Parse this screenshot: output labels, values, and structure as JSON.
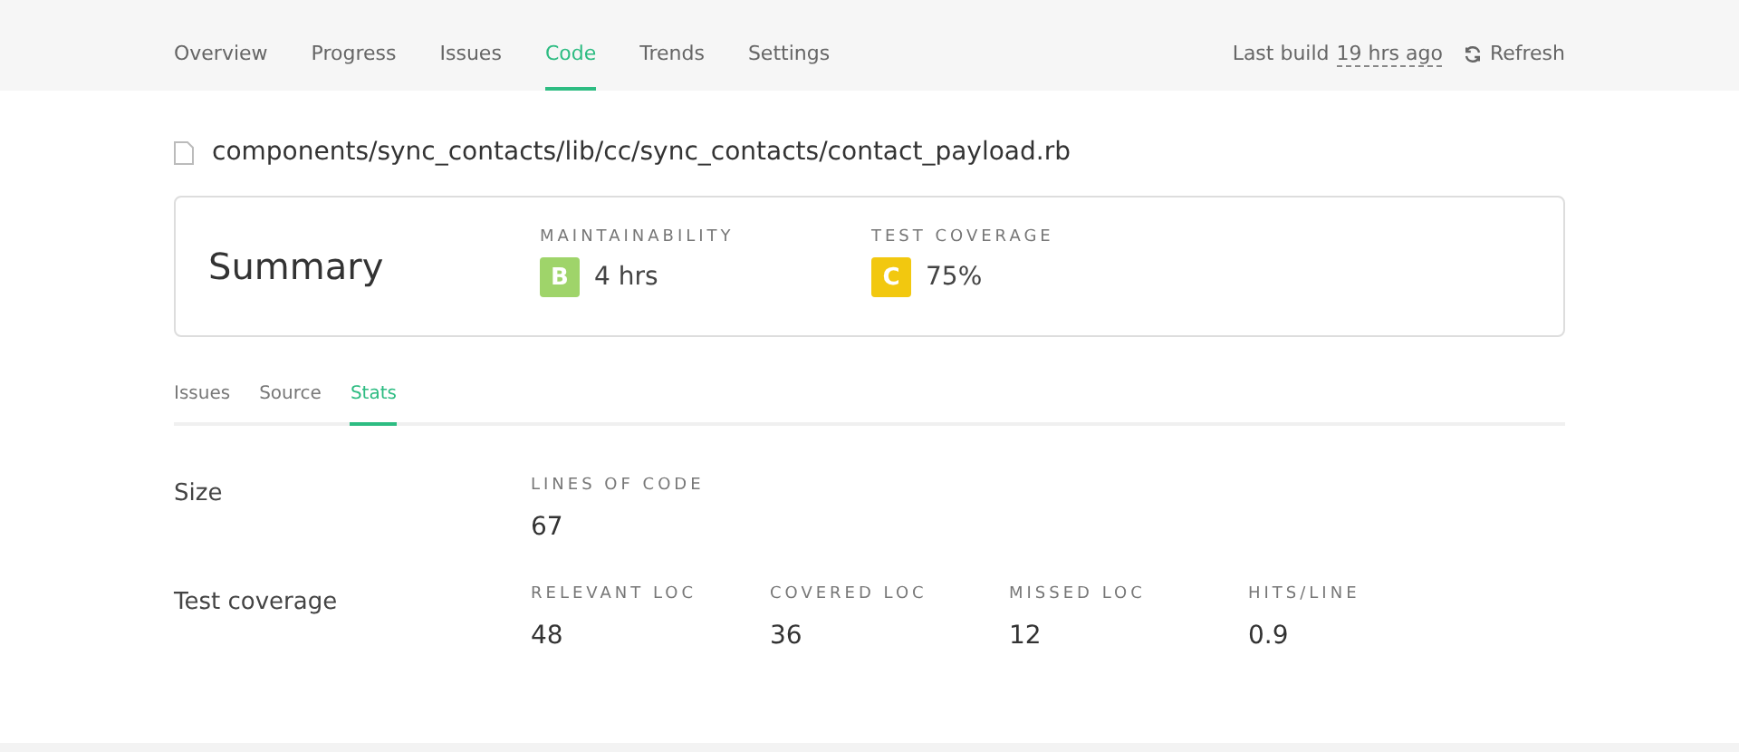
{
  "nav": {
    "tabs": [
      {
        "label": "Overview",
        "selected": false
      },
      {
        "label": "Progress",
        "selected": false
      },
      {
        "label": "Issues",
        "selected": false
      },
      {
        "label": "Code",
        "selected": true
      },
      {
        "label": "Trends",
        "selected": false
      },
      {
        "label": "Settings",
        "selected": false
      }
    ],
    "last_build_label": "Last build",
    "last_build_time": "19 hrs ago",
    "refresh": "Refresh"
  },
  "file_path": "components/sync_contacts/lib/cc/sync_contacts/contact_payload.rb",
  "summary": {
    "title": "Summary",
    "metrics": [
      {
        "label": "MAINTAINABILITY",
        "grade": "B",
        "color": "#9fd46a",
        "value": "4 hrs"
      },
      {
        "label": "TEST COVERAGE",
        "grade": "C",
        "color": "#f2c80f",
        "value": "75%"
      }
    ]
  },
  "sub_tabs": [
    {
      "label": "Issues",
      "selected": false
    },
    {
      "label": "Source",
      "selected": false
    },
    {
      "label": "Stats",
      "selected": true
    }
  ],
  "stats": [
    {
      "title": "Size",
      "fields": [
        {
          "label": "LINES OF CODE",
          "value": "67"
        }
      ]
    },
    {
      "title": "Test coverage",
      "fields": [
        {
          "label": "RELEVANT LOC",
          "value": "48"
        },
        {
          "label": "COVERED LOC",
          "value": "36"
        },
        {
          "label": "MISSED LOC",
          "value": "12"
        },
        {
          "label": "HITS/LINE",
          "value": "0.9"
        }
      ]
    }
  ]
}
